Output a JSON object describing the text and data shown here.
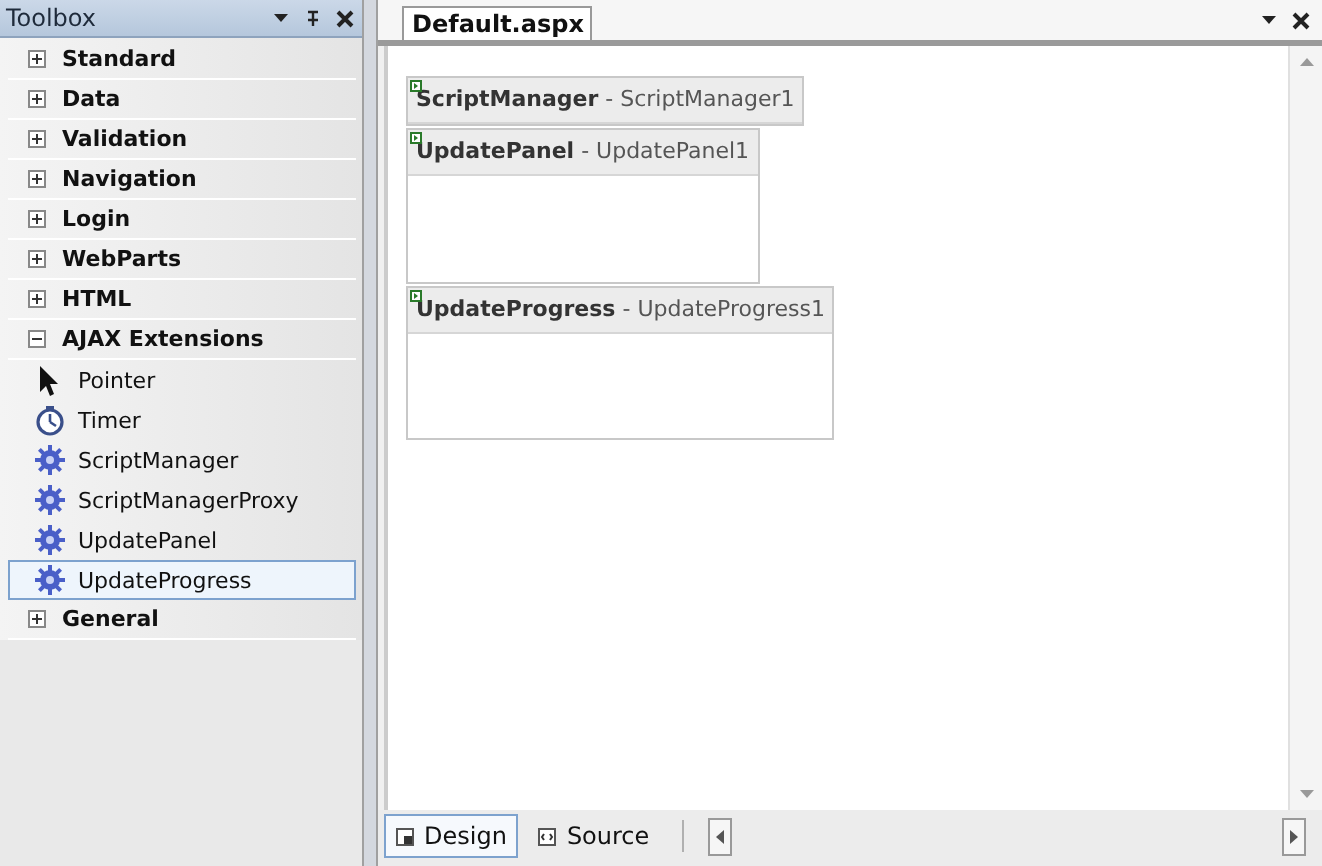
{
  "toolbox": {
    "title": "Toolbox",
    "categories": [
      {
        "label": "Standard",
        "expanded": false
      },
      {
        "label": "Data",
        "expanded": false
      },
      {
        "label": "Validation",
        "expanded": false
      },
      {
        "label": "Navigation",
        "expanded": false
      },
      {
        "label": "Login",
        "expanded": false
      },
      {
        "label": "WebParts",
        "expanded": false
      },
      {
        "label": "HTML",
        "expanded": false
      },
      {
        "label": "AJAX Extensions",
        "expanded": true,
        "children": [
          {
            "label": "Pointer",
            "kind": "pointer",
            "selected": false
          },
          {
            "label": "Timer",
            "kind": "timer",
            "selected": false
          },
          {
            "label": "ScriptManager",
            "kind": "gear",
            "selected": false
          },
          {
            "label": "ScriptManagerProxy",
            "kind": "gear",
            "selected": false
          },
          {
            "label": "UpdatePanel",
            "kind": "gear",
            "selected": false
          },
          {
            "label": "UpdateProgress",
            "kind": "gear",
            "selected": true
          }
        ]
      },
      {
        "label": "General",
        "expanded": false
      }
    ]
  },
  "document": {
    "tab": "Default.aspx",
    "controls": [
      {
        "kind": "script-manager",
        "type": "ScriptManager",
        "instance": "- ScriptManager1"
      },
      {
        "kind": "update-panel",
        "type": "UpdatePanel",
        "instance": "- UpdatePanel1"
      },
      {
        "kind": "update-progress",
        "type": "UpdateProgress",
        "instance": "- UpdateProgress1"
      }
    ]
  },
  "view_tabs": [
    {
      "label": "Design",
      "kind": "design",
      "selected": true
    },
    {
      "label": "Source",
      "kind": "source",
      "selected": false
    }
  ]
}
